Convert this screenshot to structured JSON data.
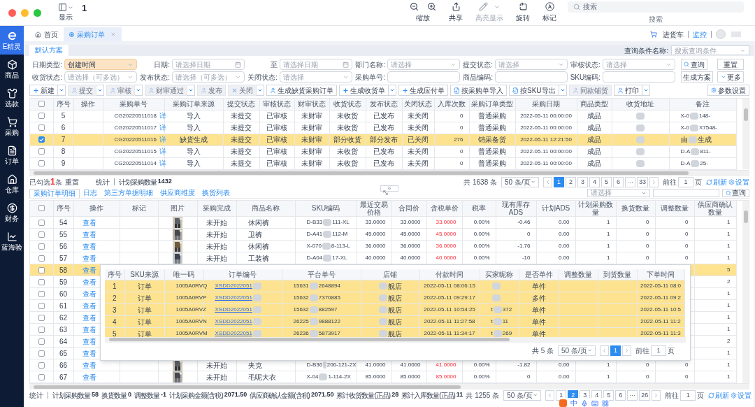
{
  "toolbar": {
    "title": "1",
    "view_label": "显示",
    "items": [
      {
        "label": "缩放",
        "kind": "zoom",
        "disabled": false
      },
      {
        "label": "共享",
        "kind": "share",
        "disabled": false
      },
      {
        "label": "高亮显示",
        "kind": "highlight",
        "disabled": true
      },
      {
        "label": "旋转",
        "kind": "rotate",
        "disabled": false
      },
      {
        "label": "标记",
        "kind": "markup",
        "disabled": false
      }
    ],
    "search": {
      "placeholder": "搜索",
      "label": "搜索"
    }
  },
  "sidebar": {
    "items": [
      {
        "label": "E精灵",
        "kind": "logo",
        "selected": true
      },
      {
        "label": "商品",
        "kind": "box",
        "selected": false
      },
      {
        "label": "选款",
        "kind": "shirt",
        "selected": false
      },
      {
        "label": "采购",
        "kind": "cart",
        "selected": false
      },
      {
        "label": "订单",
        "kind": "doc",
        "selected": false
      },
      {
        "label": "仓库",
        "kind": "house",
        "selected": false
      },
      {
        "label": "财务",
        "kind": "money",
        "selected": false
      },
      {
        "label": "蓝海验",
        "kind": "chart",
        "selected": false
      }
    ]
  },
  "tabs": [
    {
      "label": "首页",
      "kind": "home",
      "selected": false,
      "closable": false
    },
    {
      "label": "采购订单",
      "kind": "page",
      "selected": true,
      "closable": true
    }
  ],
  "header_links": {
    "cart": "进货车",
    "monitor": "监控"
  },
  "filter": {
    "scheme_tab": "默认方案",
    "query_name_label": "查询条件名称:",
    "query_name_placeholder": "搜索查询条件",
    "rows": [
      [
        {
          "label": "日期类型:",
          "kind": "select",
          "value": "创建时间",
          "highlighted": true
        },
        {
          "label": "日期:",
          "kind": "date",
          "placeholder": "请选择日期",
          "highlighted": false
        },
        {
          "label": "至",
          "kind": "date",
          "placeholder": "请选择日期",
          "highlighted": false
        },
        {
          "label": "部门名称:",
          "kind": "select",
          "placeholder": "请选择",
          "highlighted": false
        },
        {
          "label": "提交状态:",
          "kind": "select",
          "placeholder": "请选择",
          "highlighted": false
        },
        {
          "label": "审核状态:",
          "kind": "select",
          "placeholder": "请选择",
          "highlighted": false
        }
      ],
      [
        {
          "label": "收货状态:",
          "kind": "select",
          "placeholder": "请选择（可多选）",
          "highlighted": false
        },
        {
          "label": "发布状态:",
          "kind": "select",
          "placeholder": "请选择（可多选）",
          "highlighted": false
        },
        {
          "label": "关闭状态:",
          "kind": "select",
          "placeholder": "请选择",
          "highlighted": false
        },
        {
          "label": "采购单号:",
          "kind": "text",
          "highlighted": false
        },
        {
          "label": "商品编码:",
          "kind": "text",
          "highlighted": false
        },
        {
          "label": "SKU编码:",
          "kind": "text",
          "highlighted": false
        }
      ]
    ],
    "query_button": "查询",
    "reset_button": "重置",
    "scheme_button": "生成方案",
    "more_button": "更多"
  },
  "actions": [
    {
      "label": "新建",
      "kind": "create",
      "dropdown": true,
      "disabled": false
    },
    {
      "label": "提交",
      "kind": "person",
      "dropdown": true,
      "disabled": true
    },
    {
      "label": "审核",
      "kind": "person",
      "dropdown": true,
      "disabled": true
    },
    {
      "label": "财审通过",
      "kind": "person",
      "dropdown": true,
      "disabled": true
    },
    {
      "label": "发布",
      "kind": "person",
      "dropdown": false,
      "disabled": true
    },
    {
      "label": "关闭",
      "kind": "cancel",
      "dropdown": true,
      "disabled": true
    },
    {
      "label": "生成缺货采购订单",
      "kind": "person",
      "dropdown": false,
      "disabled": false
    },
    {
      "label": "生成收货单",
      "kind": "create",
      "dropdown": true,
      "disabled": false
    },
    {
      "label": "生成应付单",
      "kind": "create",
      "dropdown": false,
      "disabled": false
    },
    {
      "label": "按采购单导入",
      "kind": "import",
      "dropdown": false,
      "disabled": false
    },
    {
      "label": "按SKU导出",
      "kind": "export",
      "dropdown": true,
      "disabled": false
    },
    {
      "label": "同款铺货",
      "kind": "person",
      "dropdown": false,
      "disabled": true
    },
    {
      "label": "打印",
      "kind": "person",
      "dropdown": true,
      "disabled": false
    }
  ],
  "settings_button": "参数设置",
  "top_table": {
    "all_checked": false,
    "columns": [
      {
        "label": "序号"
      },
      {
        "label": "操作"
      },
      {
        "label": "采购单号",
        "kind": "code"
      },
      {
        "label": "采购订单来源"
      },
      {
        "label": "提交状态"
      },
      {
        "label": "审核状态"
      },
      {
        "label": "财审状态"
      },
      {
        "label": "收货状态"
      },
      {
        "label": "发布状态"
      },
      {
        "label": "关闭状态"
      },
      {
        "label": "入库次数",
        "kind": "number"
      },
      {
        "label": "采购订单类型"
      },
      {
        "label": "采购日期",
        "kind": "datetime"
      },
      {
        "label": "商品类型"
      },
      {
        "label": "收货地址"
      },
      {
        "label": "备注",
        "kind": "code"
      }
    ],
    "rows": [
      {
        "checked": false,
        "selected": false,
        "cells": [
          "5",
          null,
          {
            "text": "CG20220511018",
            "link": "详"
          },
          "导入",
          "未提交",
          "已审核",
          "未财审",
          "未收货",
          "已发布",
          "未关闭",
          "0",
          "普通采购",
          "2022-05-11 00:00:00",
          "成品",
          {
            "redacted": true
          },
          {
            "pre": "X-0",
            "redacted": true,
            "post": "148-"
          }
        ]
      },
      {
        "checked": false,
        "selected": false,
        "cells": [
          "6",
          null,
          {
            "text": "CG20220511017",
            "link": "详"
          },
          "导入",
          "未提交",
          "已审核",
          "未财审",
          "未收货",
          "已发布",
          "未关闭",
          "0",
          "普通采购",
          "2022-05-11 00:00:00",
          "成品",
          {
            "redacted": true
          },
          {
            "pre": "X-0",
            "redacted": true,
            "post": "X7548-"
          }
        ]
      },
      {
        "checked": true,
        "selected": true,
        "cells": [
          "7",
          null,
          {
            "text": "CG20220511016",
            "link": "详"
          },
          "缺货生成",
          "未提交",
          "已审核",
          "未财审",
          "部分收货",
          "部分发布",
          "已关闭",
          "276",
          "销采备货",
          "2022-05-11 12:21:50",
          "成品",
          {
            "redacted": true
          },
          {
            "pre": "由",
            "redacted": true,
            "post": "生成"
          }
        ]
      },
      {
        "checked": false,
        "selected": false,
        "cells": [
          "8",
          null,
          {
            "text": "CG20220511015",
            "link": "详"
          },
          "导入",
          "未提交",
          "已审核",
          "未财审",
          "未收货",
          "已发布",
          "未关闭",
          "0",
          "普通采购",
          "2022-05-11 00:00:00",
          "成品",
          {
            "redacted": true
          },
          {
            "pre": "D-A",
            "redacted": true,
            "post": "811-"
          }
        ]
      },
      {
        "checked": false,
        "selected": false,
        "cells": [
          "9",
          null,
          {
            "text": "CG20220511014",
            "link": "详"
          },
          "导入",
          "未提交",
          "已审核",
          "未财审",
          "未收货",
          "已发布",
          "未关闭",
          "0",
          "普通采购",
          "2022-05-11 00:00:00",
          "成品",
          {
            "redacted": true
          },
          {
            "pre": "D-A",
            "redacted": true,
            "post": "25-"
          }
        ]
      }
    ]
  },
  "top_footer": {
    "selected_prefix": "已勾选",
    "selected_count": "1",
    "selected_suffix": "条",
    "reset": "重置",
    "stats_label": "统计",
    "stats": [
      {
        "label": "计划采购数量",
        "value": "1432"
      }
    ]
  },
  "top_pagination": {
    "total": "共 1638 条",
    "page_size": "50 条/页",
    "pages": [
      {
        "label": "1",
        "selected": true
      },
      {
        "label": "2",
        "selected": false
      },
      {
        "label": "3",
        "selected": false
      },
      {
        "label": "4",
        "selected": false
      },
      {
        "label": "5",
        "selected": false
      },
      {
        "label": "6",
        "selected": false
      },
      {
        "label": "···",
        "selected": false
      },
      {
        "label": "33",
        "selected": false
      }
    ],
    "goto_label": "前往",
    "goto_value": "1",
    "page_unit": "页",
    "refresh": "刷新",
    "settings": "设置"
  },
  "bottom_tabs": [
    {
      "label": "采购订单明细",
      "selected": true
    },
    {
      "label": "日志",
      "selected": false
    },
    {
      "label": "第三方单据明细",
      "selected": false
    },
    {
      "label": "供应商维度",
      "selected": false
    },
    {
      "label": "换货列表",
      "selected": false
    }
  ],
  "bottom_search": {
    "select_placeholder": "请选择",
    "button": "查询"
  },
  "bottom_table": {
    "all_checked": false,
    "columns": [
      {
        "label": "序号"
      },
      {
        "label": "操作",
        "kind": "action"
      },
      {
        "label": "标记"
      },
      {
        "label": "图片"
      },
      {
        "label": "采购完成"
      },
      {
        "label": "商品名称",
        "kind": "text"
      },
      {
        "label": "SKU编码",
        "kind": "code"
      },
      {
        "label": "最近交易价格",
        "kind": "number"
      },
      {
        "label": "合同价",
        "kind": "number"
      },
      {
        "label": "含税单价",
        "kind": "price"
      },
      {
        "label": "税率",
        "kind": "number"
      },
      {
        "label": "现有库存ADS",
        "kind": "number"
      },
      {
        "label": "计划ADS",
        "kind": "number"
      },
      {
        "label": "计划采购数量",
        "kind": "number"
      },
      {
        "label": "换货数量",
        "kind": "number"
      },
      {
        "label": "调整数量",
        "kind": "number"
      },
      {
        "label": "供应商确认数量",
        "kind": "number"
      }
    ],
    "rows": [
      {
        "checked": false,
        "selected": false,
        "cells": [
          "54",
          "查看",
          null,
          {
            "kind": "picture"
          },
          "未开始",
          "休闲裤",
          {
            "pre": "D-B33",
            "redacted": true,
            "post": "111-XL"
          },
          "33.0000",
          "33.0000",
          "33.0000",
          "0.00%",
          "-0.46",
          "0.00",
          "1",
          "0",
          "0",
          "1"
        ]
      },
      {
        "checked": false,
        "selected": false,
        "cells": [
          "55",
          "查看",
          null,
          {
            "kind": "picture"
          },
          "未开始",
          "卫裤",
          {
            "pre": "D-A41",
            "redacted": true,
            "post": "112-M"
          },
          "45.0000",
          "45.0000",
          "45.0000",
          "0.00%",
          "0",
          "0.00",
          "1",
          "0",
          "0",
          "1"
        ]
      },
      {
        "checked": false,
        "selected": false,
        "cells": [
          "56",
          "查看",
          null,
          {
            "kind": "picture"
          },
          "未开始",
          "休闲裤",
          {
            "pre": "X-070",
            "redacted": true,
            "post": "8-113-L"
          },
          "36.0000",
          "36.0000",
          "36.0000",
          "0.00%",
          "-1.76",
          "0.00",
          "1",
          "0",
          "0",
          "1"
        ]
      },
      {
        "checked": false,
        "selected": false,
        "cells": [
          "57",
          "查看",
          null,
          {
            "kind": "picture"
          },
          "未开始",
          "工装裤",
          {
            "pre": "D-A04",
            "redacted": true,
            "post": "17-XL"
          },
          "40.0000",
          "40.0000",
          "40.0000",
          "0.00%",
          "-10",
          "0.00",
          "1",
          "0",
          "0",
          "1"
        ]
      },
      {
        "checked": false,
        "selected": true,
        "cells": [
          "58",
          "查看",
          null,
          null,
          null,
          null,
          null,
          null,
          null,
          null,
          null,
          null,
          null,
          null,
          null,
          null,
          "5"
        ]
      },
      {
        "checked": false,
        "selected": false,
        "cells": [
          "59",
          "查看",
          null,
          null,
          null,
          null,
          null,
          null,
          null,
          null,
          null,
          null,
          null,
          null,
          null,
          null,
          "2"
        ]
      },
      {
        "checked": false,
        "selected": false,
        "cells": [
          "60",
          "查看",
          null,
          null,
          null,
          null,
          null,
          null,
          null,
          null,
          null,
          null,
          null,
          null,
          null,
          null,
          "1"
        ]
      },
      {
        "checked": false,
        "selected": false,
        "cells": [
          "61",
          "查看",
          null,
          null,
          null,
          null,
          null,
          null,
          null,
          null,
          null,
          null,
          null,
          null,
          null,
          null,
          "1"
        ]
      },
      {
        "checked": false,
        "selected": false,
        "cells": [
          "62",
          "查看",
          null,
          null,
          null,
          null,
          null,
          null,
          null,
          null,
          null,
          null,
          null,
          null,
          null,
          null,
          "1"
        ]
      },
      {
        "checked": false,
        "selected": false,
        "cells": [
          "63",
          "查看",
          null,
          null,
          null,
          null,
          null,
          null,
          null,
          null,
          null,
          null,
          null,
          null,
          null,
          null,
          "1"
        ]
      },
      {
        "checked": false,
        "selected": false,
        "cells": [
          "64",
          "查看",
          null,
          null,
          null,
          null,
          null,
          null,
          null,
          null,
          null,
          null,
          null,
          null,
          null,
          null,
          "2"
        ]
      },
      {
        "checked": false,
        "selected": false,
        "cells": [
          "65",
          "查看",
          null,
          null,
          null,
          null,
          null,
          null,
          null,
          null,
          null,
          null,
          null,
          null,
          null,
          null,
          "1"
        ]
      },
      {
        "checked": false,
        "selected": false,
        "cells": [
          "66",
          "查看",
          null,
          {
            "kind": "picture"
          },
          "未开始",
          "夹克",
          {
            "pre": "D-B36",
            "redacted": true,
            "post": "206-121-2X"
          },
          "41.0000",
          "41.0000",
          "41.0000",
          "0.00%",
          "-1.82",
          "0.00",
          "1",
          "0",
          "0",
          "1"
        ]
      },
      {
        "checked": false,
        "selected": false,
        "cells": [
          "67",
          "查看",
          null,
          {
            "kind": "picture"
          },
          "未开始",
          "毛呢大衣",
          {
            "pre": "X-04",
            "redacted": true,
            "post": "1-114-2X"
          },
          "85.0000",
          "85.0000",
          "85.0000",
          "0.00%",
          "0",
          "0.00",
          "1",
          "0",
          "0",
          "1"
        ]
      }
    ]
  },
  "popover": {
    "columns": [
      {
        "label": "序号"
      },
      {
        "label": "SKU来源"
      },
      {
        "label": "唯一码",
        "kind": "code"
      },
      {
        "label": "订单编号",
        "kind": "link"
      },
      {
        "label": "平台单号",
        "kind": "code"
      },
      {
        "label": "店铺"
      },
      {
        "label": "付款时间",
        "kind": "datetime"
      },
      {
        "label": "买家昵称",
        "kind": "code"
      },
      {
        "label": "是否单件"
      },
      {
        "label": "调整数量"
      },
      {
        "label": "到货数量"
      },
      {
        "label": "下单时间",
        "kind": "datetime"
      }
    ],
    "rows": [
      {
        "selected": true,
        "cells": [
          "1",
          "订单",
          "1005A0RVQ",
          {
            "pre": "XSDD2022051",
            "redacted": true
          },
          {
            "pre": "15631",
            "redacted": true,
            "post": "2648894"
          },
          {
            "redacted": true,
            "post": "舰店"
          },
          "2022-05-11 08:06:15",
          {
            "redacted": true
          },
          "单件",
          null,
          null,
          "2022-05-11 08:0"
        ]
      },
      {
        "selected": true,
        "cells": [
          "2",
          "订单",
          "1005A0RVP",
          {
            "pre": "XSDD2022051",
            "redacted": true
          },
          {
            "pre": "15632",
            "redacted": true,
            "post": "7370885"
          },
          {
            "redacted": true,
            "post": "舰店"
          },
          "2022-05-11 09:29:17",
          {
            "redacted": true
          },
          "多件",
          null,
          null,
          "2022-05-11 09:2"
        ]
      },
      {
        "selected": true,
        "cells": [
          "3",
          "订单",
          "1005A0RVZ",
          {
            "pre": "XSDD2022051",
            "redacted": true
          },
          {
            "pre": "15632",
            "redacted": true,
            "post": "882597"
          },
          {
            "redacted": true,
            "post": "舰店"
          },
          "2022-05-11 10:54:25",
          {
            "pre": "t",
            "redacted": true,
            "post": "372"
          },
          "单件",
          null,
          null,
          "2022-05-11 10:5"
        ]
      },
      {
        "selected": true,
        "cells": [
          "4",
          "订单",
          "1005A0RVN",
          {
            "pre": "XSDD2022051",
            "redacted": true
          },
          {
            "pre": "26225",
            "redacted": true,
            "post": "9888122"
          },
          {
            "redacted": true,
            "post": "舰店"
          },
          "2022-05-11 11:27:58",
          {
            "pre": "t",
            "redacted": true,
            "post": "11"
          },
          "单件",
          null,
          null,
          "2022-05-11 11:2"
        ]
      },
      {
        "selected": true,
        "cells": [
          "5",
          "订单",
          "1005A0RVM",
          {
            "pre": "XSDD2022051",
            "redacted": true
          },
          {
            "pre": "26236",
            "redacted": true,
            "post": "5873917"
          },
          {
            "redacted": true,
            "post": "舰店"
          },
          "2022-05-11 11:34:17",
          {
            "pre": "t",
            "redacted": true,
            "post": "269"
          },
          "单件",
          null,
          null,
          "2022-05-11 11:3"
        ]
      }
    ],
    "pagination": {
      "total": "共 5 条",
      "page_size": "50 条/页",
      "pages": [
        {
          "label": "1",
          "selected": true
        }
      ],
      "goto_label": "前往",
      "goto_value": "1",
      "page_unit": "页"
    }
  },
  "bottom_footer": {
    "stats_label": "统计",
    "stats": [
      {
        "label": "计划采购数量",
        "value": "58"
      },
      {
        "label": "换货数量",
        "value": "0"
      },
      {
        "label": "调整数量",
        "value": "-1"
      },
      {
        "label": "计划采购金额(含税)",
        "value": "2071.50"
      },
      {
        "label": "供应商确认金额(含税)",
        "value": "2071.50"
      },
      {
        "label": "累计收货数量(正品)",
        "value": "28"
      },
      {
        "label": "累计入库数量(正品)",
        "value": "11"
      }
    ]
  },
  "bottom_pagination": {
    "total": "共 1255 条",
    "page_size": "50 条/页",
    "pages": [
      {
        "label": "1",
        "selected": false
      },
      {
        "label": "2",
        "selected": true
      },
      {
        "label": "3",
        "selected": false
      },
      {
        "label": "4",
        "selected": false
      },
      {
        "label": "5",
        "selected": false
      },
      {
        "label": "6",
        "selected": false
      },
      {
        "label": "···",
        "selected": false
      },
      {
        "label": "26",
        "selected": false
      }
    ],
    "goto_label": "前往",
    "goto_value": "1",
    "page_unit": "页",
    "refresh": "刷新",
    "settings": "设置"
  },
  "ime": {
    "mode": "中"
  }
}
